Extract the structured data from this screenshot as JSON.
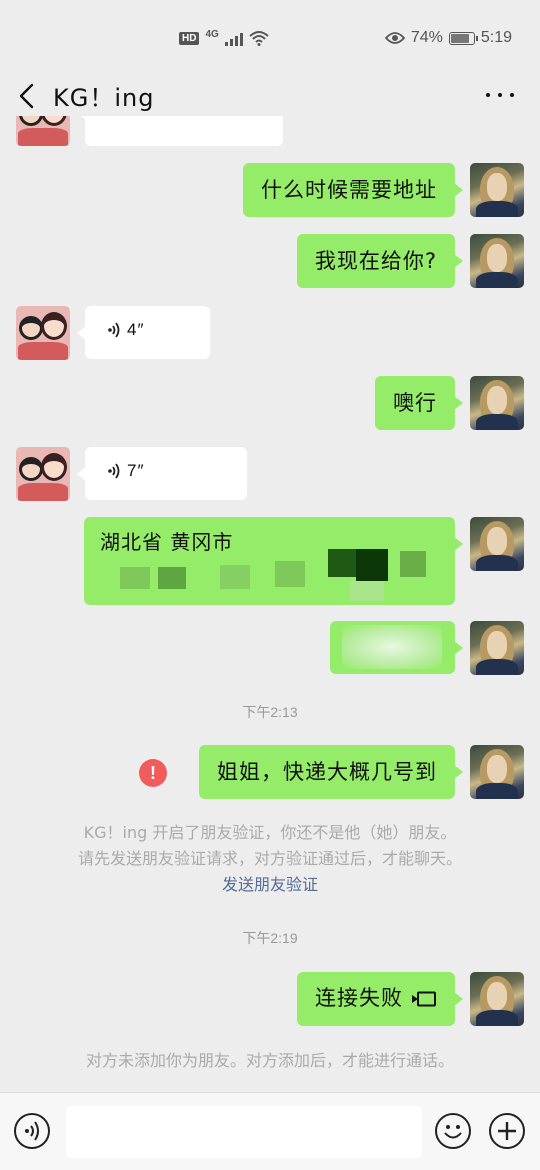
{
  "status_bar": {
    "hd": "HD",
    "network": "4G",
    "battery_percent": "74%",
    "battery_level": 0.74,
    "time": "5:19",
    "icons": [
      "signal-icon",
      "wifi-icon",
      "eye-icon",
      "battery-icon"
    ]
  },
  "header": {
    "title": "KG！ing",
    "back_icon": "chevron-left-icon",
    "more_icon": "more-dots-icon"
  },
  "messages": {
    "m1_text": "什么时候需要地址",
    "m2_text": "我现在给你?",
    "voice1_duration": "4″",
    "m3_text": "噢行",
    "voice2_duration": "7″",
    "address_line1": "湖北省 黄冈市",
    "time1": "下午2:13",
    "m4_text": "姐姐，快递大概几号到",
    "fail_mark": "!",
    "sys1_line1": "KG！ing 开启了朋友验证，你还不是他（她）朋友。",
    "sys1_line2": "请先发送朋友验证请求，对方验证通过后，才能聊天。",
    "sys1_link": "发送朋友验证",
    "time2": "下午2:19",
    "m5_text": "连接失败",
    "sys2_text": "对方未添加你为朋友。对方添加后，才能进行通话。"
  },
  "input_bar": {
    "placeholder": "",
    "icons": [
      "voice-input-icon",
      "emoji-icon",
      "plus-icon"
    ]
  },
  "colors": {
    "self_bubble": "#95ec69",
    "other_bubble": "#ffffff",
    "background": "#ededed",
    "link": "#576b95",
    "error": "#f25b5b"
  }
}
